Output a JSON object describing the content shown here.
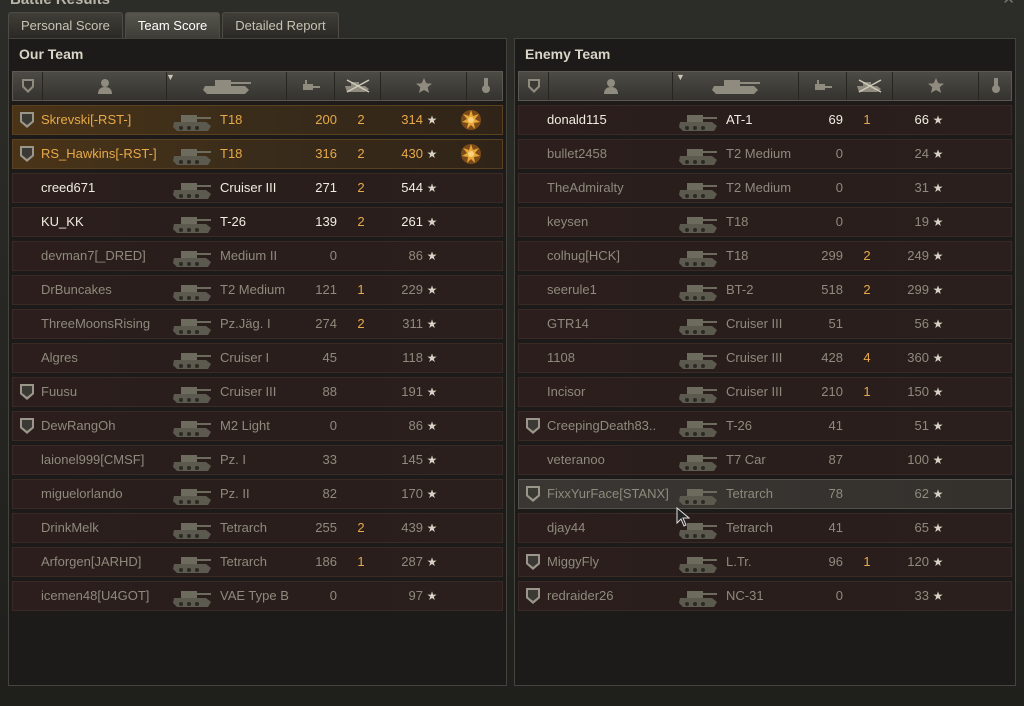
{
  "window": {
    "title": "Battle Results"
  },
  "tabs": [
    {
      "label": "Personal Score"
    },
    {
      "label": "Team Score"
    },
    {
      "label": "Detailed Report"
    }
  ],
  "our_team": {
    "title": "Our Team",
    "rows": [
      {
        "platoon": "1",
        "name": "Skrevski[-RST-]",
        "vehicle": "T18",
        "damage": "200",
        "kills": "2",
        "xp": "314",
        "medal": "medal-icon",
        "state": "me"
      },
      {
        "platoon": "1",
        "name": "RS_Hawkins[-RST-]",
        "vehicle": "T18",
        "damage": "316",
        "kills": "2",
        "xp": "430",
        "medal": "medal-icon",
        "state": "me"
      },
      {
        "platoon": "",
        "name": "creed671",
        "vehicle": "Cruiser III",
        "damage": "271",
        "kills": "2",
        "xp": "544",
        "state": "alive"
      },
      {
        "platoon": "",
        "name": "KU_KK",
        "vehicle": "T-26",
        "damage": "139",
        "kills": "2",
        "xp": "261",
        "state": "alive"
      },
      {
        "platoon": "",
        "name": "devman7[_DRED]",
        "vehicle": "Medium II",
        "damage": "0",
        "kills": "",
        "xp": "86",
        "state": "dead"
      },
      {
        "platoon": "",
        "name": "DrBuncakes",
        "vehicle": "T2 Medium",
        "damage": "121",
        "kills": "1",
        "xp": "229",
        "state": "dead"
      },
      {
        "platoon": "",
        "name": "ThreeMoonsRising",
        "vehicle": "Pz.Jäg. I",
        "damage": "274",
        "kills": "2",
        "xp": "311",
        "state": "dead"
      },
      {
        "platoon": "",
        "name": "Algres",
        "vehicle": "Cruiser I",
        "damage": "45",
        "kills": "",
        "xp": "118",
        "state": "dead"
      },
      {
        "platoon": "1",
        "name": "Fuusu",
        "vehicle": "Cruiser III",
        "damage": "88",
        "kills": "",
        "xp": "191",
        "state": "dead"
      },
      {
        "platoon": "2",
        "name": "DewRangOh",
        "vehicle": "M2 Light",
        "damage": "0",
        "kills": "",
        "xp": "86",
        "state": "dead"
      },
      {
        "platoon": "",
        "name": "laionel999[CMSF]",
        "vehicle": "Pz. I",
        "damage": "33",
        "kills": "",
        "xp": "145",
        "state": "dead"
      },
      {
        "platoon": "",
        "name": "miguelorlando",
        "vehicle": "Pz. II",
        "damage": "82",
        "kills": "",
        "xp": "170",
        "state": "dead"
      },
      {
        "platoon": "",
        "name": "DrinkMelk",
        "vehicle": "Tetrarch",
        "damage": "255",
        "kills": "2",
        "xp": "439",
        "state": "dead"
      },
      {
        "platoon": "",
        "name": "Arforgen[JARHD]",
        "vehicle": "Tetrarch",
        "damage": "186",
        "kills": "1",
        "xp": "287",
        "state": "dead"
      },
      {
        "platoon": "",
        "name": "icemen48[U4GOT]",
        "vehicle": "VAE Type B",
        "damage": "0",
        "kills": "",
        "xp": "97",
        "state": "dead"
      }
    ]
  },
  "enemy_team": {
    "title": "Enemy Team",
    "rows": [
      {
        "platoon": "",
        "name": "donald115",
        "vehicle": "AT-1",
        "damage": "69",
        "kills": "1",
        "xp": "66",
        "state": "alive"
      },
      {
        "platoon": "",
        "name": "bullet2458",
        "vehicle": "T2 Medium",
        "damage": "0",
        "kills": "",
        "xp": "24",
        "state": "dead"
      },
      {
        "platoon": "",
        "name": "TheAdmiralty",
        "vehicle": "T2 Medium",
        "damage": "0",
        "kills": "",
        "xp": "31",
        "state": "dead"
      },
      {
        "platoon": "",
        "name": "keysen",
        "vehicle": "T18",
        "damage": "0",
        "kills": "",
        "xp": "19",
        "state": "dead"
      },
      {
        "platoon": "",
        "name": "colhug[HCK]",
        "vehicle": "T18",
        "damage": "299",
        "kills": "2",
        "xp": "249",
        "state": "dead"
      },
      {
        "platoon": "",
        "name": "seerule1",
        "vehicle": "BT-2",
        "damage": "518",
        "kills": "2",
        "xp": "299",
        "state": "dead"
      },
      {
        "platoon": "",
        "name": "GTR14",
        "vehicle": "Cruiser III",
        "damage": "51",
        "kills": "",
        "xp": "56",
        "state": "dead"
      },
      {
        "platoon": "",
        "name": "1108",
        "vehicle": "Cruiser III",
        "damage": "428",
        "kills": "4",
        "xp": "360",
        "state": "dead"
      },
      {
        "platoon": "",
        "name": "Incisor",
        "vehicle": "Cruiser III",
        "damage": "210",
        "kills": "1",
        "xp": "150",
        "state": "dead"
      },
      {
        "platoon": "1",
        "name": "CreepingDeath83..",
        "vehicle": "T-26",
        "damage": "41",
        "kills": "",
        "xp": "51",
        "state": "dead"
      },
      {
        "platoon": "",
        "name": "veteranoo",
        "vehicle": "T7 Car",
        "damage": "87",
        "kills": "",
        "xp": "100",
        "state": "dead"
      },
      {
        "platoon": "1",
        "name": "FixxYurFace[STANX]",
        "vehicle": "Tetrarch",
        "damage": "78",
        "kills": "",
        "xp": "62",
        "state": "hover"
      },
      {
        "platoon": "",
        "name": "djay44",
        "vehicle": "Tetrarch",
        "damage": "41",
        "kills": "",
        "xp": "65",
        "state": "dead"
      },
      {
        "platoon": "2",
        "name": "MiggyFly",
        "vehicle": "L.Tr.",
        "damage": "96",
        "kills": "1",
        "xp": "120",
        "state": "dead"
      },
      {
        "platoon": "2",
        "name": "redraider26",
        "vehicle": "NC-31",
        "damage": "0",
        "kills": "",
        "xp": "33",
        "state": "dead"
      }
    ]
  },
  "icons": {
    "star": "★",
    "close": "✕"
  }
}
